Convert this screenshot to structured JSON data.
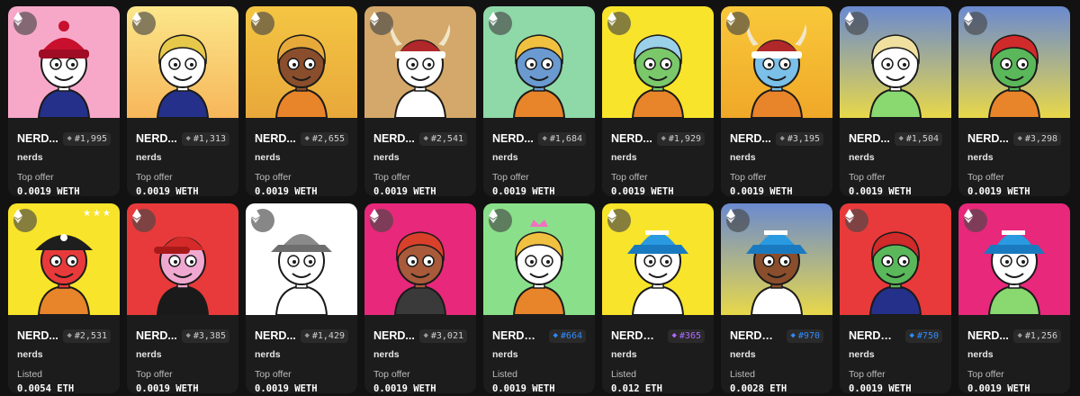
{
  "cards": [
    {
      "name": "NERD...",
      "rank": "#1,995",
      "rank_color": "#9a9a9a",
      "collection": "nerds",
      "offer_label": "Top offer",
      "price": "0.0019 WETH",
      "bg": [
        "#f7a8c9",
        "#f7a8c9"
      ],
      "skin": "#ffffff",
      "hair": "#c8102e",
      "hat": "beanie-red",
      "shirt": "#25308a",
      "stars": ""
    },
    {
      "name": "NERD...",
      "rank": "#1,313",
      "rank_color": "#9a9a9a",
      "collection": "nerds",
      "offer_label": "Top offer",
      "price": "0.0019 WETH",
      "bg": [
        "#fce68a",
        "#f7b65a"
      ],
      "skin": "#ffffff",
      "hair": "#e6c94a",
      "hat": "",
      "shirt": "#25308a",
      "stars": ""
    },
    {
      "name": "NERD...",
      "rank": "#2,655",
      "rank_color": "#9a9a9a",
      "collection": "nerds",
      "offer_label": "Top offer",
      "price": "0.0019 WETH",
      "bg": [
        "#f4c543",
        "#e8a83a"
      ],
      "skin": "#8a4e2c",
      "hair": "#e6a93a",
      "hat": "",
      "shirt": "#e8842a",
      "stars": ""
    },
    {
      "name": "NERD...",
      "rank": "#2,541",
      "rank_color": "#9a9a9a",
      "collection": "nerds",
      "offer_label": "Top offer",
      "price": "0.0019 WETH",
      "bg": [
        "#d4a86a",
        "#d4a86a"
      ],
      "skin": "#ffffff",
      "hair": "#8a2a20",
      "hat": "viking",
      "shirt": "#ffffff",
      "stars": ""
    },
    {
      "name": "NERD...",
      "rank": "#1,684",
      "rank_color": "#9a9a9a",
      "collection": "nerds",
      "offer_label": "Top offer",
      "price": "0.0019 WETH",
      "bg": [
        "#8fd8a8",
        "#8fd8a8"
      ],
      "skin": "#6a9ad0",
      "hair": "#f0c040",
      "hat": "",
      "shirt": "#e8842a",
      "stars": ""
    },
    {
      "name": "NERD...",
      "rank": "#1,929",
      "rank_color": "#9a9a9a",
      "collection": "nerds",
      "offer_label": "Top offer",
      "price": "0.0019 WETH",
      "bg": [
        "#f8e42a",
        "#f8e42a"
      ],
      "skin": "#7ac86a",
      "hair": "#9ad0e8",
      "hat": "",
      "shirt": "#e8842a",
      "stars": ""
    },
    {
      "name": "NERD...",
      "rank": "#3,195",
      "rank_color": "#9a9a9a",
      "collection": "nerds",
      "offer_label": "Top offer",
      "price": "0.0019 WETH",
      "bg": [
        "#f8c83a",
        "#f0a828"
      ],
      "skin": "#7ac0e8",
      "hair": "#d0d0d0",
      "hat": "viking",
      "shirt": "#e8842a",
      "stars": ""
    },
    {
      "name": "NERD...",
      "rank": "#1,504",
      "rank_color": "#9a9a9a",
      "collection": "nerds",
      "offer_label": "Top offer",
      "price": "0.0019 WETH",
      "bg": [
        "#6a8ad0",
        "#e8d84a"
      ],
      "skin": "#ffffff",
      "hair": "#f0e0a0",
      "hat": "",
      "shirt": "#8ad870",
      "stars": ""
    },
    {
      "name": "NERD...",
      "rank": "#3,298",
      "rank_color": "#9a9a9a",
      "collection": "nerds",
      "offer_label": "Top offer",
      "price": "0.0019 WETH",
      "bg": [
        "#6a8ad0",
        "#e8d84a"
      ],
      "skin": "#5ab85a",
      "hair": "#d02a2a",
      "hat": "",
      "shirt": "#e8842a",
      "stars": ""
    },
    {
      "name": "NERD...",
      "rank": "#2,531",
      "rank_color": "#9a9a9a",
      "collection": "nerds",
      "offer_label": "Listed",
      "price": "0.0054 ETH",
      "bg": [
        "#f8e42a",
        "#f8e42a"
      ],
      "skin": "#e83a3a",
      "hair": "#202020",
      "hat": "pirate",
      "shirt": "#e8842a",
      "stars": "★★★"
    },
    {
      "name": "NERD...",
      "rank": "#3,385",
      "rank_color": "#9a9a9a",
      "collection": "nerds",
      "offer_label": "Top offer",
      "price": "0.0019 WETH",
      "bg": [
        "#e83a3a",
        "#e83a3a"
      ],
      "skin": "#f0a8d0",
      "hair": "#ffffff",
      "hat": "cap-red",
      "shirt": "#1a1a1a",
      "stars": ""
    },
    {
      "name": "NERD...",
      "rank": "#1,429",
      "rank_color": "#9a9a9a",
      "collection": "nerds",
      "offer_label": "Top offer",
      "price": "0.0019 WETH",
      "bg": [
        "#ffffff",
        "#ffffff"
      ],
      "skin": "#ffffff",
      "hair": "#888888",
      "hat": "bucket-grey",
      "shirt": "#ffffff",
      "stars": ""
    },
    {
      "name": "NERD...",
      "rank": "#3,021",
      "rank_color": "#9a9a9a",
      "collection": "nerds",
      "offer_label": "Top offer",
      "price": "0.0019 WETH",
      "bg": [
        "#e8287a",
        "#e8287a"
      ],
      "skin": "#a85a3a",
      "hair": "#d8402a",
      "hat": "",
      "shirt": "#3a3a3a",
      "stars": ""
    },
    {
      "name": "NERDs ...",
      "rank": "#664",
      "rank_color": "#2f8cff",
      "collection": "nerds",
      "offer_label": "Listed",
      "price": "0.0019 WETH",
      "bg": [
        "#8ae08a",
        "#8ae08a"
      ],
      "skin": "#ffffff",
      "hair": "#f0c040",
      "hat": "crown-pink",
      "shirt": "#e8842a",
      "stars": ""
    },
    {
      "name": "NERDs ...",
      "rank": "#365",
      "rank_color": "#b06aff",
      "collection": "nerds",
      "offer_label": "Listed",
      "price": "0.012 ETH",
      "bg": [
        "#f8e42a",
        "#f8e42a"
      ],
      "skin": "#ffffff",
      "hair": "#202020",
      "hat": "bucket-blue",
      "shirt": "#ffffff",
      "stars": ""
    },
    {
      "name": "NERDs ...",
      "rank": "#970",
      "rank_color": "#2f8cff",
      "collection": "nerds",
      "offer_label": "Listed",
      "price": "0.0028 ETH",
      "bg": [
        "#6a8ad0",
        "#e8d84a"
      ],
      "skin": "#8a4e2c",
      "hair": "#202020",
      "hat": "bucket-blue",
      "shirt": "#ffffff",
      "stars": ""
    },
    {
      "name": "NERDs ...",
      "rank": "#750",
      "rank_color": "#2f8cff",
      "collection": "nerds",
      "offer_label": "Top offer",
      "price": "0.0019 WETH",
      "bg": [
        "#e83a3a",
        "#e83a3a"
      ],
      "skin": "#5ab85a",
      "hair": "#d02a2a",
      "hat": "",
      "shirt": "#25308a",
      "stars": ""
    },
    {
      "name": "NERD...",
      "rank": "#1,256",
      "rank_color": "#9a9a9a",
      "collection": "nerds",
      "offer_label": "Top offer",
      "price": "0.0019 WETH",
      "bg": [
        "#e8287a",
        "#e8287a"
      ],
      "skin": "#ffffff",
      "hair": "#f0c040",
      "hat": "bucket-blue",
      "shirt": "#8ad870",
      "stars": ""
    }
  ]
}
